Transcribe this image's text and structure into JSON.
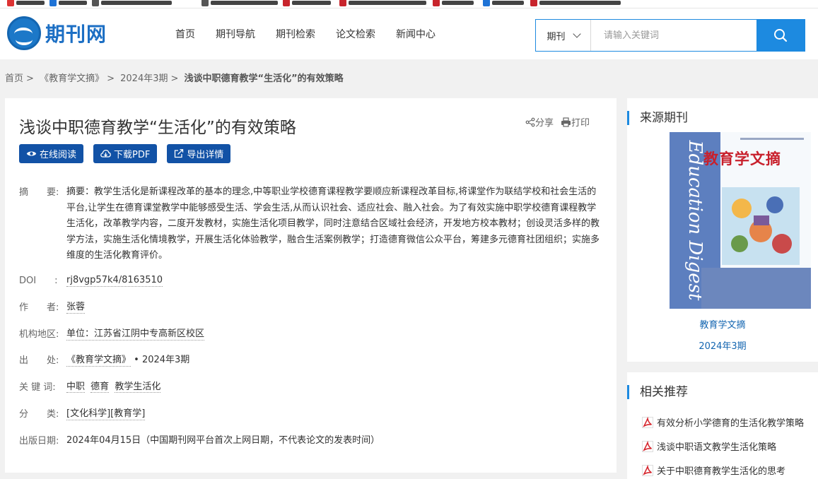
{
  "site": {
    "logo_text": "期刊网"
  },
  "nav": [
    "首页",
    "期刊导航",
    "期刊检索",
    "论文检索",
    "新闻中心"
  ],
  "search": {
    "type": "期刊",
    "placeholder": "请输入关键词"
  },
  "breadcrumb": {
    "home": "首页",
    "journal": "《教育学文摘》",
    "issue": "2024年3期",
    "current": "浅谈中职德育教学“生活化”的有效策略"
  },
  "article": {
    "title": "浅谈中职德育教学“生活化”的有效策略",
    "share": "分享",
    "print": "打印",
    "read_online": "在线阅读",
    "download_pdf": "下载PDF",
    "export": "导出详情",
    "fields": {
      "abstract_label": "摘　　要:",
      "abstract": "摘要：教学生活化是新课程改革的基本的理念,中等职业学校德育课程教学要顺应新课程改革目标,将课堂作为联结学校和社会生活的平台,让学生在德育课堂教学中能够感受生活、学会生活,从而认识社会、适应社会、融入社会。为了有效实施中职学校德育课程教学生活化，改革教学内容，二度开发教材，实施生活化项目教学，同时注意结合区域社会经济，开发地方校本教材；创设灵活多样的教学方法，实施生活化情境教学，开展生活化体验教学，融合生活案例教学；打造德育微信公众平台，筹建多元德育社团组织；实施多维度的生活化教育评价。",
      "doi_label": "DOI　　:",
      "doi": "rj8vgp57k4/8163510",
      "author_label": "作　　者:",
      "author": "张蓉",
      "org_label": "机构地区:",
      "org": "单位：江苏省江阴中专高新区校区",
      "source_label": "出　　处:",
      "source_journal": "《教育学文摘》",
      "source_issue": " • 2024年3期",
      "keywords_label": "关  键  词:",
      "keywords": [
        "中职",
        "德育",
        "教学生活化"
      ],
      "category_label": "分　　类:",
      "category": "[文化科学][教育学]",
      "date_label": "出版日期:",
      "date": "2024年04月15日（中国期刊网平台首次上网日期，不代表论文的发表时间）"
    }
  },
  "sidebar": {
    "source_title": "来源期刊",
    "cover_title": "教育学文摘",
    "cover_spine": "Education Digest",
    "journal_name": "教育学文摘",
    "journal_issue": "2024年3期",
    "related_title": "相关推荐",
    "related": [
      "有效分析小学德育的生活化教学策略",
      "浅谈中职语文教学生活化策略",
      "关于中职德育教学生活化的思考"
    ]
  },
  "colors": {
    "primary": "#1252a6",
    "accent": "#1d8ae0",
    "pdf_icon": "#d6262e"
  }
}
